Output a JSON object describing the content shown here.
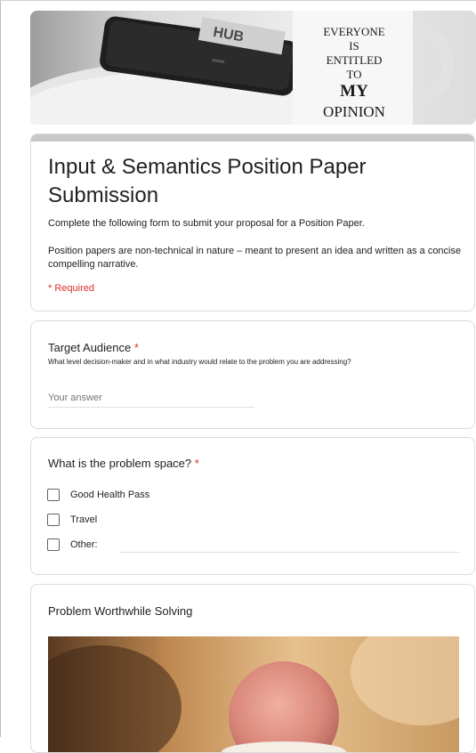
{
  "banner": {
    "image_alt": "Mug and phone header image",
    "mug_text": [
      "EVERYONE",
      "IS",
      "ENTITLED",
      "TO",
      "MY",
      "OPINION"
    ]
  },
  "form": {
    "title": "Input & Semantics Position Paper Submission",
    "description_1": "Complete the following form to submit your proposal for a Position Paper.",
    "description_2": "Position papers are non-technical in nature – meant to present an idea and written as a concise compelling narrative.",
    "required_note": "* Required"
  },
  "questions": {
    "audience": {
      "title": "Target Audience",
      "required_mark": "*",
      "help": "What level decision-maker and in what industry would relate to the problem you are addressing?",
      "placeholder": "Your answer",
      "value": ""
    },
    "problem_space": {
      "title": "What is the problem space?",
      "required_mark": "*",
      "options": [
        {
          "label": "Good Health Pass",
          "checked": false
        },
        {
          "label": "Travel",
          "checked": false
        },
        {
          "label": "Other:",
          "checked": false
        }
      ]
    },
    "worthwhile": {
      "title": "Problem Worthwhile Solving"
    }
  },
  "colors": {
    "required": "#d93025",
    "border": "#dadce0",
    "title_bar": "#c8c8c8"
  }
}
